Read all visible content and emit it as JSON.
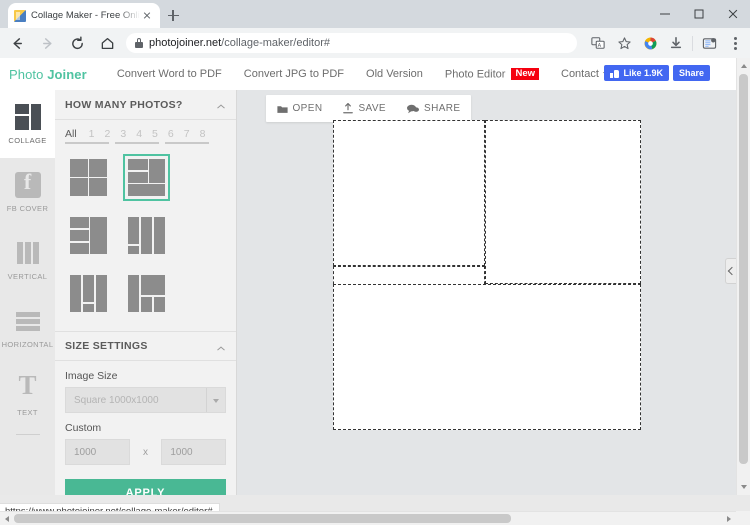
{
  "browser": {
    "tab": {
      "title": "Collage Maker - Free Online Ph",
      "favicon": "photojoiner-favicon",
      "close": "×"
    },
    "new_tab": "+",
    "window_controls": {
      "minimize": "minimize",
      "maximize": "maximize",
      "close": "close"
    },
    "nav": {
      "back": "back-arrow",
      "forward": "forward-arrow",
      "reload": "reload",
      "home": "home"
    },
    "omnibox": {
      "lock": "secure-lock",
      "url_domain": "photojoiner.net",
      "url_path": "/collage-maker/editor#"
    },
    "toolbar_icons": [
      "translate-icon",
      "bookmark-star-icon",
      "extension-icon",
      "download-icon",
      "profile-icon",
      "menu-kebab-icon"
    ]
  },
  "site_nav": {
    "brand_light": "Photo ",
    "brand_bold": "Joiner",
    "links": [
      {
        "label": "Convert Word to PDF"
      },
      {
        "label": "Convert JPG to PDF"
      },
      {
        "label": "Old Version"
      },
      {
        "label": "Photo Editor",
        "badge": "New"
      },
      {
        "label": "Contact",
        "caret": true
      }
    ],
    "facebook": {
      "like_label": "Like 1.9K",
      "share_label": "Share",
      "brand_color": "#4267f1"
    }
  },
  "rail": {
    "items": [
      {
        "label": "COLLAGE",
        "icon": "collage-grid-icon",
        "active": true
      },
      {
        "label": "FB COVER",
        "icon": "facebook-icon",
        "active": false
      },
      {
        "label": "VERTICAL",
        "icon": "vertical-bars-icon",
        "active": false
      },
      {
        "label": "HORIZONTAL",
        "icon": "horizontal-bars-icon",
        "active": false
      },
      {
        "label": "TEXT",
        "icon": "text-t-icon",
        "active": false
      }
    ]
  },
  "panel": {
    "photos_section": {
      "title": "HOW MANY PHOTOS?",
      "collapse_icon": "chevron-up-icon",
      "counts": [
        "All",
        "1",
        "2",
        "3",
        "4",
        "5",
        "6",
        "7",
        "8"
      ],
      "selected_count": "All",
      "layouts": [
        {
          "name": "layout-2x2",
          "selected": false
        },
        {
          "name": "layout-selected-3-plus-bottom",
          "selected": true
        },
        {
          "name": "layout-left-3-right-1",
          "selected": false
        },
        {
          "name": "layout-3-cols-split",
          "selected": false
        },
        {
          "name": "layout-3-cols-center-split",
          "selected": false
        },
        {
          "name": "layout-mixed",
          "selected": false
        }
      ]
    },
    "size_section": {
      "title": "SIZE SETTINGS",
      "collapse_icon": "chevron-up-icon",
      "image_size_label": "Image Size",
      "image_size_value": "Square 1000x1000",
      "custom_label": "Custom",
      "custom_width": "1000",
      "custom_height": "1000",
      "multiply_symbol": "x",
      "apply_label": "APPLY",
      "apply_color": "#49b894"
    }
  },
  "editor": {
    "actions": [
      {
        "label": "OPEN",
        "icon": "folder-icon"
      },
      {
        "label": "SAVE",
        "icon": "upload-icon"
      },
      {
        "label": "SHARE",
        "icon": "speech-bubble-icon"
      }
    ],
    "collapse_panel_icon": "chevron-left-icon",
    "canvas_cells": 4
  },
  "status_bar": {
    "link_url": "https://www.photojoiner.net/collage-maker/editor#"
  },
  "accent_color": "#4fc3a1"
}
